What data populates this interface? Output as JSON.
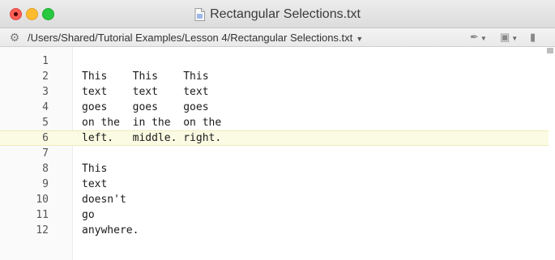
{
  "window": {
    "title": "Rectangular Selections.txt"
  },
  "pathbar": {
    "path": "/Users/Shared/Tutorial Examples/Lesson 4/Rectangular Selections.txt"
  },
  "editor": {
    "current_line": 6,
    "lines": [
      {
        "num": "1",
        "text": ""
      },
      {
        "num": "2",
        "text": "This    This    This"
      },
      {
        "num": "3",
        "text": "text    text    text"
      },
      {
        "num": "4",
        "text": "goes    goes    goes"
      },
      {
        "num": "5",
        "text": "on the  in the  on the"
      },
      {
        "num": "6",
        "text": "left.   middle. right."
      },
      {
        "num": "7",
        "text": ""
      },
      {
        "num": "8",
        "text": "This"
      },
      {
        "num": "9",
        "text": "text"
      },
      {
        "num": "10",
        "text": "doesn't"
      },
      {
        "num": "11",
        "text": "go"
      },
      {
        "num": "12",
        "text": "anywhere."
      }
    ]
  },
  "icons": {
    "window_controls": [
      "close-button",
      "minimize-button",
      "zoom-button"
    ],
    "title_icon": "text-document-icon",
    "pathbar_left": "gear-icon",
    "pathbar_right": [
      "marker-pen-icon",
      "document-list-icon",
      "document-info-icon"
    ]
  }
}
